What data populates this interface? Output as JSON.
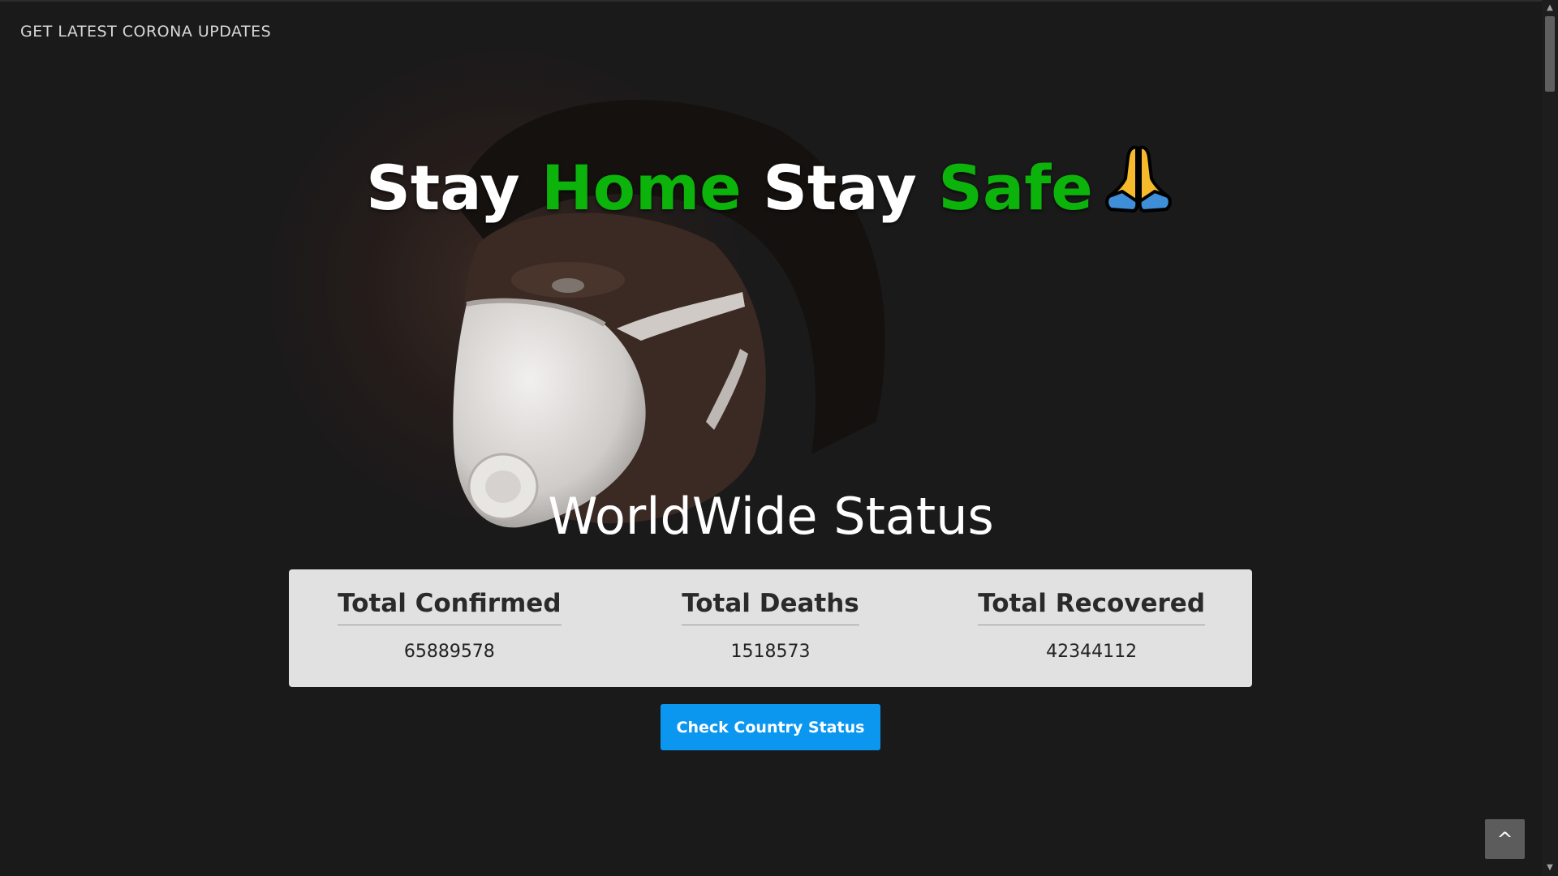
{
  "nav": {
    "brand": "GET LATEST CORONA UPDATES"
  },
  "hero": {
    "headline_words": [
      "Stay",
      "Home",
      "Stay",
      "Safe"
    ],
    "headline_emoji": "folded-hands-icon",
    "accent_color": "#0bb30b",
    "subheadline": "WorldWide Status"
  },
  "stats": {
    "items": [
      {
        "label": "Total Confirmed",
        "value": "65889578"
      },
      {
        "label": "Total Deaths",
        "value": "1518573"
      },
      {
        "label": "Total Recovered",
        "value": "42344112"
      }
    ]
  },
  "actions": {
    "check_country_label": "Check Country Status",
    "button_color": "#0b97f0",
    "scroll_top_label": "^"
  },
  "scrollbar": {
    "up_arrow": "▲",
    "down_arrow": "▼"
  }
}
